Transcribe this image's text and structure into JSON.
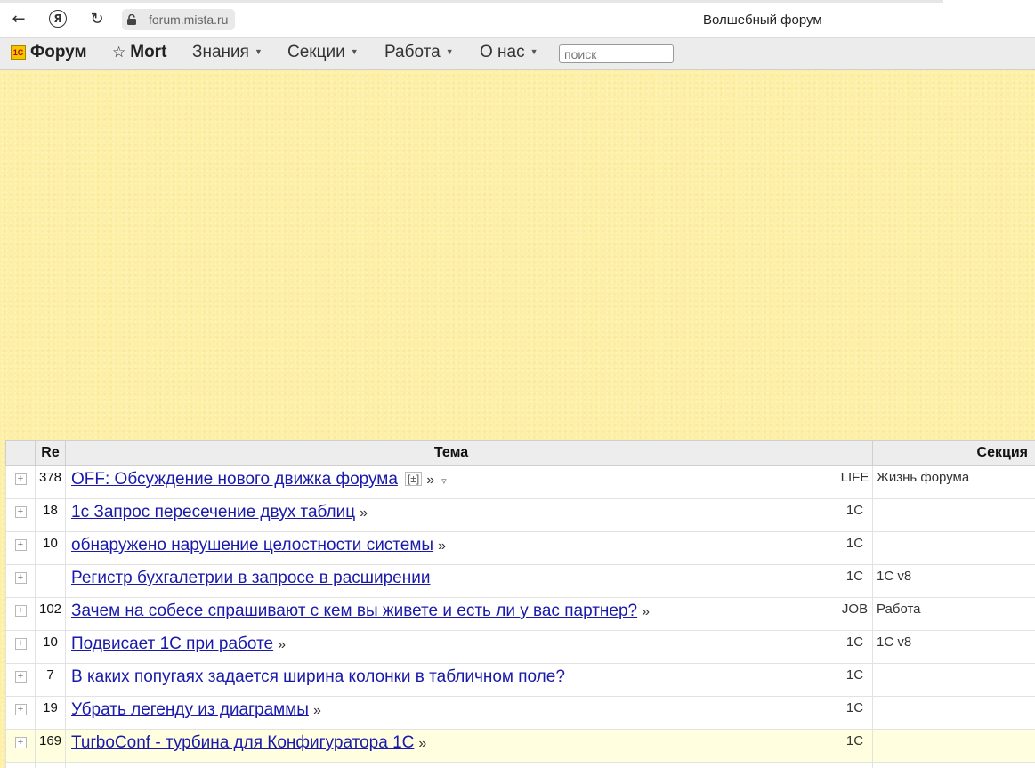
{
  "browser": {
    "url": "forum.mista.ru",
    "tab_title": "Волшебный форум",
    "back_icon": "←",
    "yandex_icon": "Я",
    "reload_icon": "↻"
  },
  "menu": {
    "forum": "Форум",
    "mort": "Mort",
    "knowledge": "Знания",
    "sections": "Секции",
    "work": "Работа",
    "about": "О нас",
    "search_placeholder": "поиск"
  },
  "table": {
    "headers": {
      "re": "Re",
      "topic": "Тема",
      "section": "Секция"
    },
    "rows": [
      {
        "re": "378",
        "title": "OFF: Обсуждение нового движка форума",
        "has_pm": true,
        "tail": "»",
        "has_tri": true,
        "code": "LIFE",
        "section": "Жизнь форума",
        "highlight": false
      },
      {
        "re": "18",
        "title": "1с Запрос пересечение двух таблиц",
        "has_pm": false,
        "tail": "»",
        "has_tri": false,
        "code": "1C",
        "section": "",
        "highlight": false
      },
      {
        "re": "10",
        "title": "обнаружено нарушение целостности системы",
        "has_pm": false,
        "tail": "»",
        "has_tri": false,
        "code": "1C",
        "section": "",
        "highlight": false
      },
      {
        "re": "",
        "title": "Регистр бухгалетрии в запросе в расширении",
        "has_pm": false,
        "tail": "",
        "has_tri": false,
        "code": "1C",
        "section": "1C v8",
        "highlight": false
      },
      {
        "re": "102",
        "title": "Зачем на собесе спрашивают с кем вы живете и есть ли у вас партнер?",
        "has_pm": false,
        "tail": "»",
        "has_tri": false,
        "code": "JOB",
        "section": "Работа",
        "highlight": false
      },
      {
        "re": "10",
        "title": "Подвисает 1С при работе",
        "has_pm": false,
        "tail": "»",
        "has_tri": false,
        "code": "1C",
        "section": "1C v8",
        "highlight": false
      },
      {
        "re": "7",
        "title": "В каких попугаях задается ширина колонки в табличном поле?",
        "has_pm": false,
        "tail": "",
        "has_tri": false,
        "code": "1C",
        "section": "",
        "highlight": false
      },
      {
        "re": "19",
        "title": "Убрать легенду из диаграммы",
        "has_pm": false,
        "tail": "»",
        "has_tri": false,
        "code": "1C",
        "section": "",
        "highlight": false
      },
      {
        "re": "169",
        "title": "TurboConf - турбина для Конфигуратора 1С",
        "has_pm": false,
        "tail": "»",
        "has_tri": false,
        "code": "1C",
        "section": "",
        "highlight": true
      },
      {
        "re": "",
        "title": "",
        "has_pm": false,
        "tail": "",
        "has_tri": false,
        "code": "",
        "section": "",
        "highlight": false
      }
    ],
    "expand_icon": "+",
    "pm_label": "[±]",
    "tri_icon": "▿"
  }
}
